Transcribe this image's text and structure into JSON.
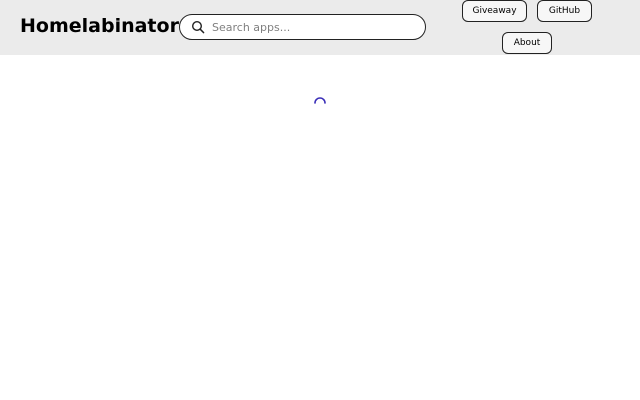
{
  "header": {
    "title": "Homelabinator",
    "search": {
      "placeholder": "Search apps...",
      "value": ""
    },
    "nav": {
      "giveaway_label": "Giveaway",
      "github_label": "GitHub",
      "about_label": "About"
    }
  },
  "main": {
    "loading_indicator": "spinner-icon",
    "spinner_color": "#3b2fb8"
  }
}
